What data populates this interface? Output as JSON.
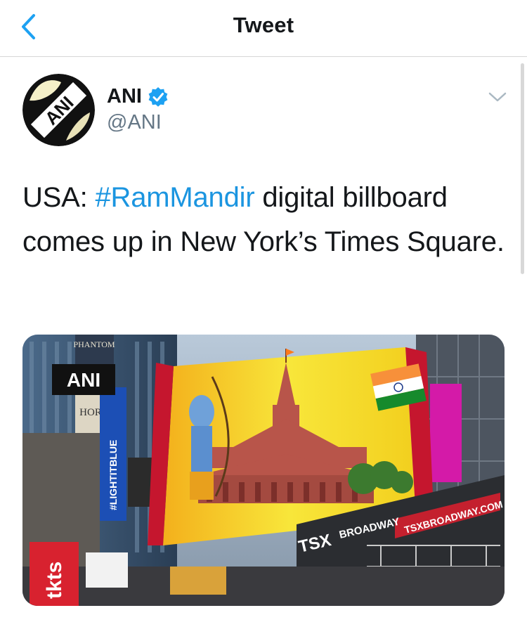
{
  "nav": {
    "title": "Tweet",
    "back_icon": "chevron-left-icon"
  },
  "tweet": {
    "author_name": "ANI",
    "author_handle": "@ANI",
    "avatar_text": "ANI",
    "text_prefix": "USA: ",
    "hashtag": "#RamMandir",
    "text_suffix": " digital billboard comes up in New York’s Times Square."
  },
  "media": {
    "watermark": "ANI",
    "signs": {
      "phantom": "PHANTOM",
      "lightitblue": "#LIGHTITBLUE",
      "tkts": "tkts",
      "broadway": "BROADWAY",
      "tsx": "TSX",
      "tsxbroadway": "TSXBROADWAY.COM"
    }
  },
  "colors": {
    "link": "#1b95e0",
    "text": "#14171a",
    "secondary": "#657786",
    "verified": "#1da1f2"
  }
}
